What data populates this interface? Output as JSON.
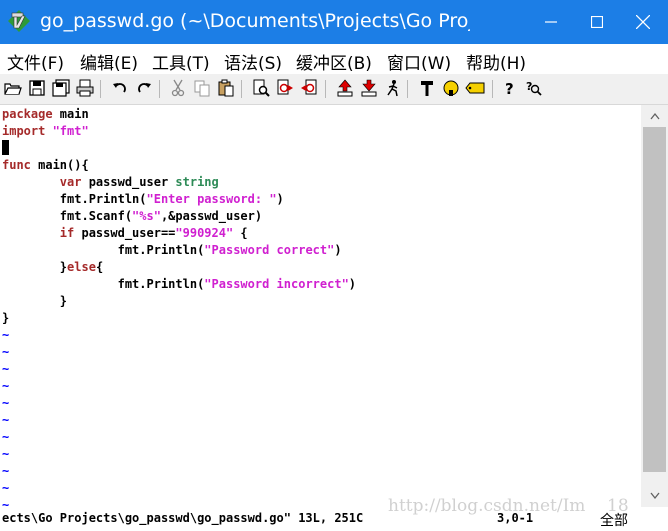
{
  "window": {
    "title": "go_passwd.go (~\\Documents\\Projects\\Go Proj..."
  },
  "menu": [
    "文件(F)",
    "编辑(E)",
    "工具(T)",
    "语法(S)",
    "缓冲区(B)",
    "窗口(W)",
    "帮助(H)"
  ],
  "toolbar_icons": [
    "open-icon",
    "save-icon",
    "save-all-icon",
    "print-icon",
    "undo-icon",
    "redo-icon",
    "cut-icon",
    "copy-icon",
    "paste-icon",
    "find-replace-icon",
    "find-next-icon",
    "find-prev-icon",
    "load-session-icon",
    "save-session-icon",
    "run-script-icon",
    "make-icon",
    "run-ctags-icon",
    "jump-tag-icon",
    "help-icon",
    "find-help-icon"
  ],
  "editor": {
    "lines": [
      [
        {
          "t": "package",
          "c": "kw"
        },
        {
          "t": " main",
          "c": ""
        }
      ],
      [
        {
          "t": "import",
          "c": "kw"
        },
        {
          "t": " \"fmt\"",
          "c": "str"
        }
      ],
      [],
      [
        {
          "t": "func",
          "c": "kw"
        },
        {
          "t": " main(){",
          "c": ""
        }
      ],
      [
        {
          "t": "        ",
          "c": ""
        },
        {
          "t": "var",
          "c": "kw"
        },
        {
          "t": " passwd_user ",
          "c": ""
        },
        {
          "t": "string",
          "c": "typ"
        }
      ],
      [
        {
          "t": "        fmt.Println(",
          "c": ""
        },
        {
          "t": "\"Enter password: \"",
          "c": "str"
        },
        {
          "t": ")",
          "c": ""
        }
      ],
      [
        {
          "t": "        fmt.Scanf(",
          "c": ""
        },
        {
          "t": "\"%s\"",
          "c": "str"
        },
        {
          "t": ",&passwd_user)",
          "c": ""
        }
      ],
      [
        {
          "t": "        ",
          "c": ""
        },
        {
          "t": "if",
          "c": "kw"
        },
        {
          "t": " passwd_user==",
          "c": ""
        },
        {
          "t": "\"990924\"",
          "c": "str"
        },
        {
          "t": " {",
          "c": ""
        }
      ],
      [
        {
          "t": "                fmt.Println(",
          "c": ""
        },
        {
          "t": "\"Password correct\"",
          "c": "str"
        },
        {
          "t": ")",
          "c": ""
        }
      ],
      [
        {
          "t": "        }",
          "c": ""
        },
        {
          "t": "else",
          "c": "kw"
        },
        {
          "t": "{",
          "c": ""
        }
      ],
      [
        {
          "t": "                fmt.Println(",
          "c": ""
        },
        {
          "t": "\"Password incorrect\"",
          "c": "str"
        },
        {
          "t": ")",
          "c": ""
        }
      ],
      [
        {
          "t": "        }",
          "c": ""
        }
      ],
      [
        {
          "t": "}",
          "c": ""
        }
      ]
    ],
    "empty_line_marker": "~",
    "empty_line_count": 12
  },
  "status": {
    "message": "ects\\Go Projects\\go_passwd\\go_passwd.go\" 13L, 251C",
    "position": "3,0-1",
    "percent": "全部"
  },
  "watermark": "http://blog.csdn.net/Im    18",
  "colors": {
    "titlebar": "#1c7ee6",
    "keyword": "#a52a2a",
    "string": "#d020d0",
    "type": "#2e8b57",
    "tilde": "#0000ff"
  }
}
